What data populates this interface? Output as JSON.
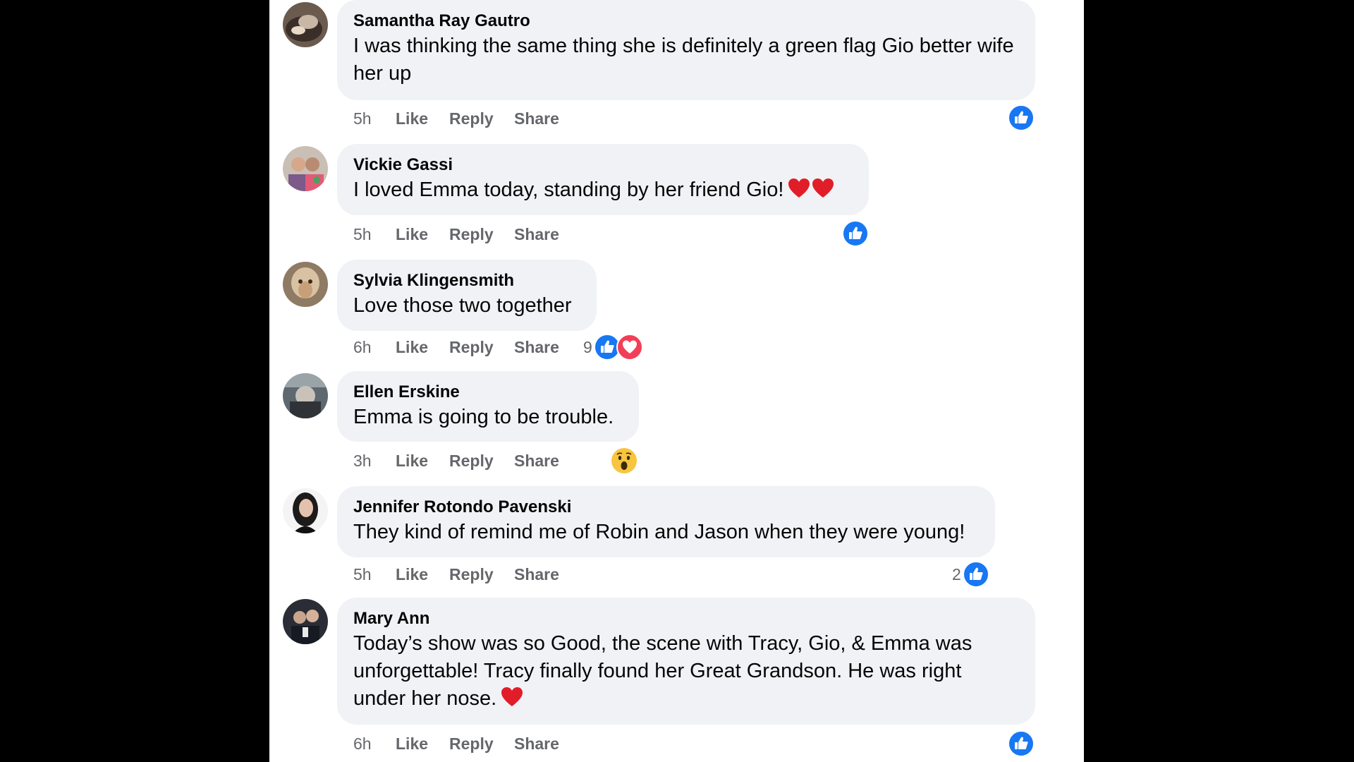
{
  "colors": {
    "like_blue": "#1877f2",
    "love_red": "#f33e58",
    "bubble_bg": "#f0f2f5",
    "meta_gray": "#65676b"
  },
  "comments": [
    {
      "author": "Samantha Ray Gautro",
      "text": "I was thinking the same thing she is definitely a green flag Gio better wife her up",
      "time": "5h",
      "like": "Like",
      "reply": "Reply",
      "share": "Share",
      "reaction_count": "",
      "reactions": [
        "like"
      ]
    },
    {
      "author": "Vickie Gassi",
      "text": "I loved Emma today, standing by her friend Gio!",
      "emoji": [
        "heart",
        "heart"
      ],
      "time": "5h",
      "like": "Like",
      "reply": "Reply",
      "share": "Share",
      "reaction_count": "",
      "reactions": [
        "like"
      ]
    },
    {
      "author": "Sylvia Klingensmith",
      "text": "Love those two together",
      "time": "6h",
      "like": "Like",
      "reply": "Reply",
      "share": "Share",
      "reaction_count": "9",
      "reactions": [
        "like",
        "love"
      ]
    },
    {
      "author": "Ellen Erskine",
      "text": "Emma is going to be trouble.",
      "time": "3h",
      "like": "Like",
      "reply": "Reply",
      "share": "Share",
      "reaction_count": "",
      "reactions": [
        "wow"
      ]
    },
    {
      "author": "Jennifer Rotondo Pavenski",
      "text": "They kind of remind me of Robin and Jason when they were young!",
      "time": "5h",
      "like": "Like",
      "reply": "Reply",
      "share": "Share",
      "reaction_count": "2",
      "reactions": [
        "like"
      ]
    },
    {
      "author": "Mary Ann",
      "text": "Today’s show was so Good, the scene with Tracy, Gio, & Emma was unforgettable! Tracy finally found her Great Grandson. He was right under her nose.",
      "emoji": [
        "heart"
      ],
      "time": "6h",
      "like": "Like",
      "reply": "Reply",
      "share": "Share",
      "reaction_count": "",
      "reactions": [
        "like"
      ]
    }
  ]
}
